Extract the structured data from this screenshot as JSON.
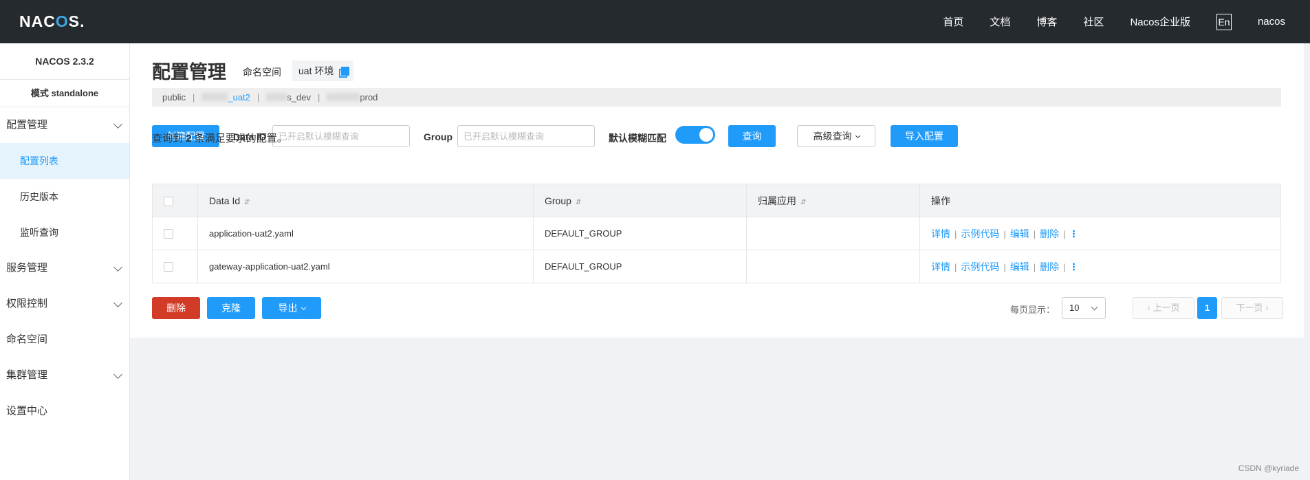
{
  "header": {
    "logo": "NACOS.",
    "nav": [
      "首页",
      "文档",
      "博客",
      "社区",
      "Nacos企业版"
    ],
    "lang": "En",
    "user": "nacos"
  },
  "sidebar": {
    "version": "NACOS 2.3.2",
    "mode": "模式 standalone",
    "items": [
      {
        "label": "配置管理",
        "expandable": true
      },
      {
        "label": "配置列表",
        "sub": true,
        "active": true
      },
      {
        "label": "历史版本",
        "sub": true
      },
      {
        "label": "监听查询",
        "sub": true
      },
      {
        "label": "服务管理",
        "expandable": true
      },
      {
        "label": "权限控制",
        "expandable": true
      },
      {
        "label": "命名空间"
      },
      {
        "label": "集群管理",
        "expandable": true
      },
      {
        "label": "设置中心"
      }
    ]
  },
  "page": {
    "title": "配置管理",
    "ns_label": "命名空间",
    "ns_current": "uat 环境",
    "namespaces": [
      {
        "label": "public"
      },
      {
        "label": "_uat2",
        "active": true
      },
      {
        "label": "s_dev"
      },
      {
        "label": "prod"
      }
    ]
  },
  "search": {
    "create_button": "创建配置",
    "data_id_label": "Data ID",
    "data_id_placeholder": "已开启默认模糊查询",
    "group_label": "Group",
    "group_placeholder": "已开启默认模糊查询",
    "fuzzy_label": "默认模糊匹配",
    "fuzzy_enabled": true,
    "query_button": "查询",
    "advanced_button": "高级查询",
    "import_button": "导入配置"
  },
  "result": {
    "prefix": "查询到",
    "count": "2",
    "suffix": "条满足要求的配置。"
  },
  "table": {
    "columns": [
      "Data Id",
      "Group",
      "归属应用",
      "操作"
    ],
    "rows": [
      {
        "data_id": "application-uat2.yaml",
        "group": "DEFAULT_GROUP",
        "app": ""
      },
      {
        "data_id": "gateway-application-uat2.yaml",
        "group": "DEFAULT_GROUP",
        "app": ""
      }
    ],
    "ops": [
      "详情",
      "示例代码",
      "编辑",
      "删除"
    ]
  },
  "footer": {
    "delete_button": "删除",
    "clone_button": "克隆",
    "export_button": "导出",
    "page_size_label": "每页显示：",
    "page_size": "10",
    "prev": "上一页",
    "current_page": "1",
    "next": "下一页"
  },
  "watermark": "CSDN @kyriade"
}
